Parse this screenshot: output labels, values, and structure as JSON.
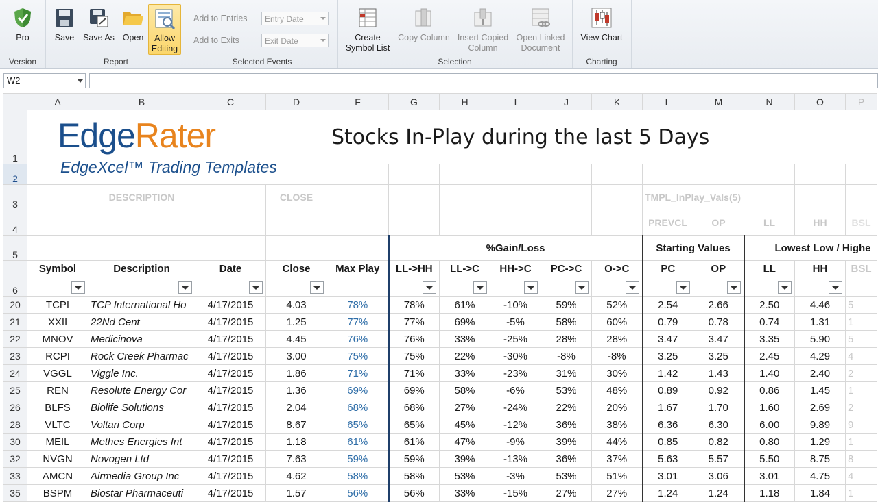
{
  "ribbon": {
    "groups": [
      {
        "label": "Version"
      },
      {
        "label": "Report"
      },
      {
        "label": "Selected Events"
      },
      {
        "label": "Selection"
      },
      {
        "label": "Charting"
      }
    ],
    "pro": "Pro",
    "save": "Save",
    "save_as": "Save As",
    "open": "Open",
    "allow_editing_1": "Allow",
    "allow_editing_2": "Editing",
    "add_entries": "Add to Entries",
    "add_exits": "Add to Exits",
    "entry_date": "Entry Date",
    "exit_date": "Exit Date",
    "create_symbol_1": "Create",
    "create_symbol_2": "Symbol List",
    "copy_column": "Copy Column",
    "insert_copied_1": "Insert Copied",
    "insert_copied_2": "Column",
    "open_linked_1": "Open Linked",
    "open_linked_2": "Document",
    "view_chart": "View Chart"
  },
  "namebox": "W2",
  "columns": [
    "A",
    "B",
    "C",
    "D",
    "F",
    "G",
    "H",
    "I",
    "J",
    "K",
    "L",
    "M",
    "N",
    "O",
    "P"
  ],
  "logo": {
    "edge": "Edge",
    "rater": "Rater",
    "sub": "EdgeXcel™ Trading Templates"
  },
  "title": "Stocks In-Play during the last 5 Days",
  "row3": {
    "description": "DESCRIPTION",
    "close": "CLOSE",
    "tmpl": "TMPL_InPlay_Vals(5)"
  },
  "row4": [
    "PREVCL",
    "OP",
    "LL",
    "HH",
    "BSL"
  ],
  "row5": {
    "gain": "%Gain/Loss",
    "starting": "Starting Values",
    "lowest": "Lowest Low / Highe"
  },
  "headers": [
    "Symbol",
    "Description",
    "Date",
    "Close",
    "Max Play",
    "LL->HH",
    "LL->C",
    "HH->C",
    "PC->C",
    "O->C",
    "PC",
    "OP",
    "LL",
    "HH",
    "BSL"
  ],
  "header_rows": [
    "1",
    "2",
    "3",
    "4",
    "5",
    "6"
  ],
  "rows": [
    {
      "r": "20",
      "sym": "TCPI",
      "desc": "TCP International Ho",
      "date": "4/17/2015",
      "close": "4.03",
      "mp": "78%",
      "llhh": "78%",
      "llc": "61%",
      "hhc": "-10%",
      "pcc": "59%",
      "oc": "52%",
      "pc": "2.54",
      "op": "2.66",
      "ll": "2.50",
      "hh": "4.46",
      "p": "5"
    },
    {
      "r": "21",
      "sym": "XXII",
      "desc": "22Nd Cent",
      "date": "4/17/2015",
      "close": "1.25",
      "mp": "77%",
      "llhh": "77%",
      "llc": "69%",
      "hhc": "-5%",
      "pcc": "58%",
      "oc": "60%",
      "pc": "0.79",
      "op": "0.78",
      "ll": "0.74",
      "hh": "1.31",
      "p": "1"
    },
    {
      "r": "22",
      "sym": "MNOV",
      "desc": "Medicinova",
      "date": "4/17/2015",
      "close": "4.45",
      "mp": "76%",
      "llhh": "76%",
      "llc": "33%",
      "hhc": "-25%",
      "pcc": "28%",
      "oc": "28%",
      "pc": "3.47",
      "op": "3.47",
      "ll": "3.35",
      "hh": "5.90",
      "p": "5"
    },
    {
      "r": "23",
      "sym": "RCPI",
      "desc": "Rock Creek Pharmac",
      "date": "4/17/2015",
      "close": "3.00",
      "mp": "75%",
      "llhh": "75%",
      "llc": "22%",
      "hhc": "-30%",
      "pcc": "-8%",
      "oc": "-8%",
      "pc": "3.25",
      "op": "3.25",
      "ll": "2.45",
      "hh": "4.29",
      "p": "4"
    },
    {
      "r": "24",
      "sym": "VGGL",
      "desc": "Viggle Inc.",
      "date": "4/17/2015",
      "close": "1.86",
      "mp": "71%",
      "llhh": "71%",
      "llc": "33%",
      "hhc": "-23%",
      "pcc": "31%",
      "oc": "30%",
      "pc": "1.42",
      "op": "1.43",
      "ll": "1.40",
      "hh": "2.40",
      "p": "2"
    },
    {
      "r": "25",
      "sym": "REN",
      "desc": "Resolute Energy Cor",
      "date": "4/17/2015",
      "close": "1.36",
      "mp": "69%",
      "llhh": "69%",
      "llc": "58%",
      "hhc": "-6%",
      "pcc": "53%",
      "oc": "48%",
      "pc": "0.89",
      "op": "0.92",
      "ll": "0.86",
      "hh": "1.45",
      "p": "1"
    },
    {
      "r": "26",
      "sym": "BLFS",
      "desc": "Biolife Solutions",
      "date": "4/17/2015",
      "close": "2.04",
      "mp": "68%",
      "llhh": "68%",
      "llc": "27%",
      "hhc": "-24%",
      "pcc": "22%",
      "oc": "20%",
      "pc": "1.67",
      "op": "1.70",
      "ll": "1.60",
      "hh": "2.69",
      "p": "2"
    },
    {
      "r": "28",
      "sym": "VLTC",
      "desc": "Voltari Corp",
      "date": "4/17/2015",
      "close": "8.67",
      "mp": "65%",
      "llhh": "65%",
      "llc": "45%",
      "hhc": "-12%",
      "pcc": "36%",
      "oc": "38%",
      "pc": "6.36",
      "op": "6.30",
      "ll": "6.00",
      "hh": "9.89",
      "p": "9"
    },
    {
      "r": "30",
      "sym": "MEIL",
      "desc": "Methes Energies Int",
      "date": "4/17/2015",
      "close": "1.18",
      "mp": "61%",
      "llhh": "61%",
      "llc": "47%",
      "hhc": "-9%",
      "pcc": "39%",
      "oc": "44%",
      "pc": "0.85",
      "op": "0.82",
      "ll": "0.80",
      "hh": "1.29",
      "p": "1"
    },
    {
      "r": "32",
      "sym": "NVGN",
      "desc": "Novogen Ltd",
      "date": "4/17/2015",
      "close": "7.63",
      "mp": "59%",
      "llhh": "59%",
      "llc": "39%",
      "hhc": "-13%",
      "pcc": "36%",
      "oc": "37%",
      "pc": "5.63",
      "op": "5.57",
      "ll": "5.50",
      "hh": "8.75",
      "p": "8"
    },
    {
      "r": "33",
      "sym": "AMCN",
      "desc": "Airmedia Group Inc",
      "date": "4/17/2015",
      "close": "4.62",
      "mp": "58%",
      "llhh": "58%",
      "llc": "53%",
      "hhc": "-3%",
      "pcc": "53%",
      "oc": "51%",
      "pc": "3.01",
      "op": "3.06",
      "ll": "3.01",
      "hh": "4.75",
      "p": "4"
    },
    {
      "r": "35",
      "sym": "BSPM",
      "desc": "Biostar Pharmaceuti",
      "date": "4/17/2015",
      "close": "1.57",
      "mp": "56%",
      "llhh": "56%",
      "llc": "33%",
      "hhc": "-15%",
      "pcc": "27%",
      "oc": "27%",
      "pc": "1.24",
      "op": "1.24",
      "ll": "1.18",
      "hh": "1.84",
      "p": "1"
    }
  ]
}
